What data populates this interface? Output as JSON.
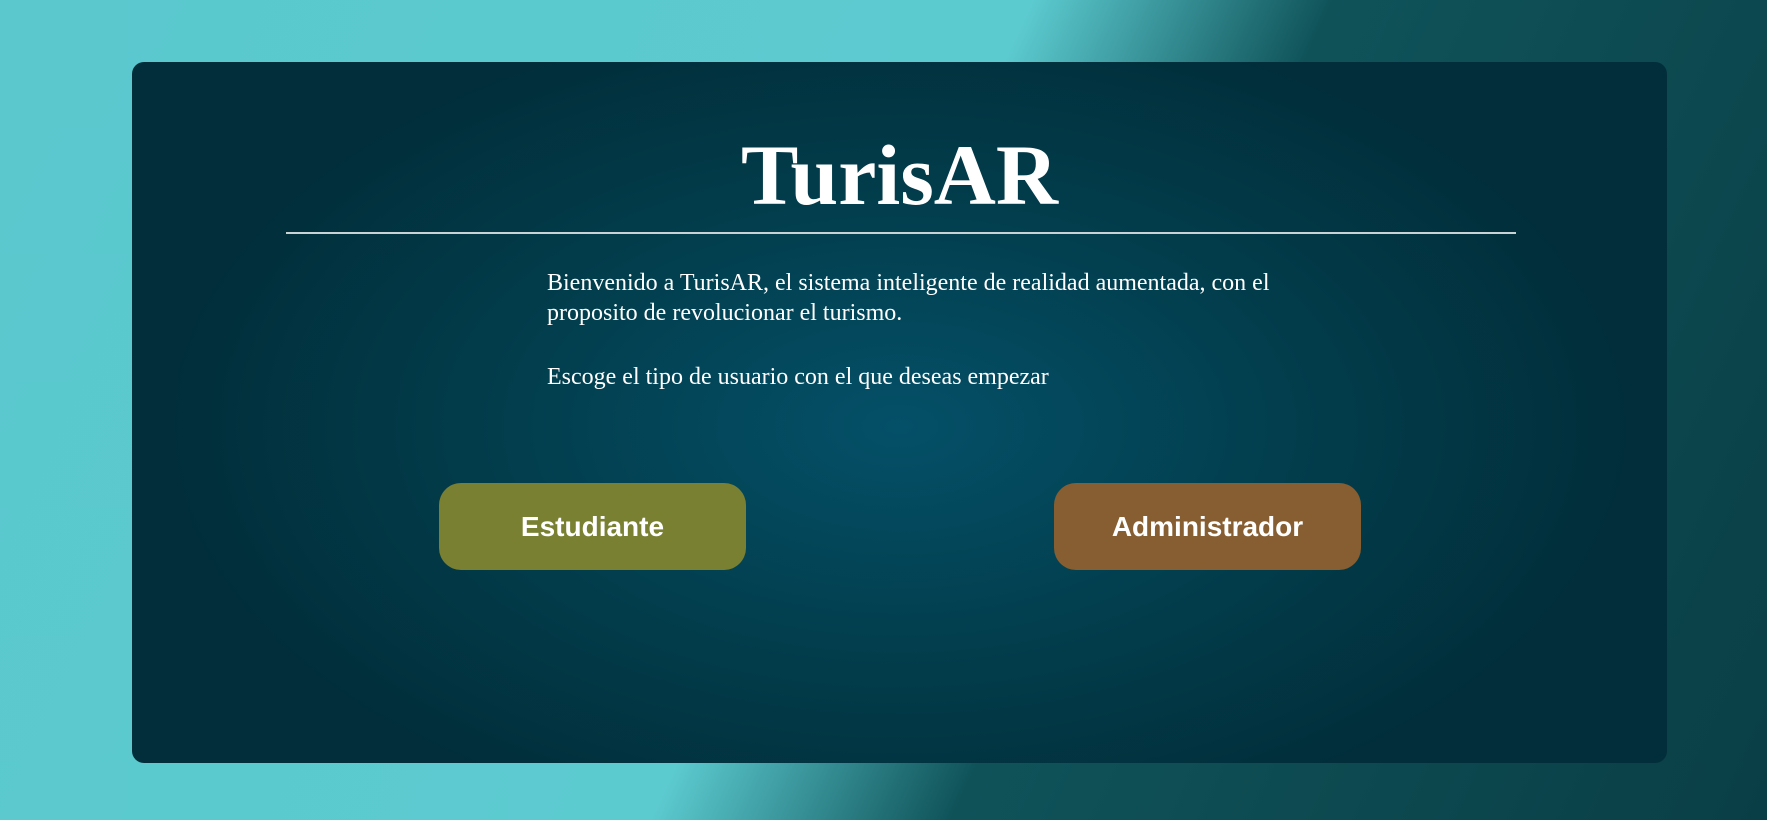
{
  "app": {
    "title": "TurisAR"
  },
  "main": {
    "description": "Bienvenido a TurisAR, el sistema inteligente de realidad aumentada, con el proposito de revolucionar el turismo.",
    "instruction": "Escoge el tipo de usuario con el que deseas empezar"
  },
  "buttons": {
    "student_label": "Estudiante",
    "admin_label": "Administrador"
  },
  "colors": {
    "student_button": "#798032",
    "admin_button": "#865e31",
    "card_background": "#023d4c",
    "page_accent": "#5ac8cd"
  }
}
